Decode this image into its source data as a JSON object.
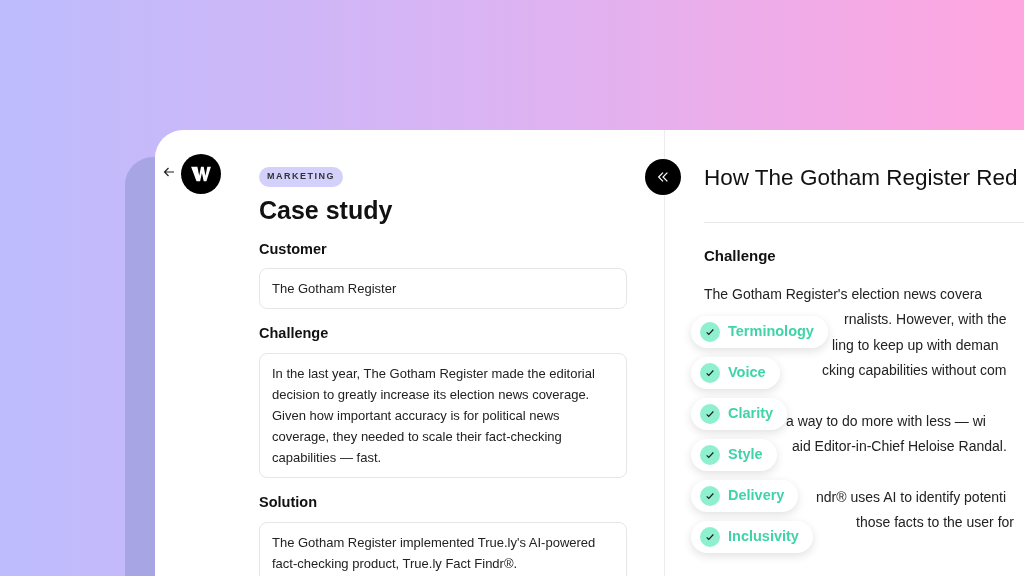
{
  "form": {
    "tag": "MARKETING",
    "title": "Case study",
    "fields": [
      {
        "label": "Customer",
        "value": "The Gotham Register"
      },
      {
        "label": "Challenge",
        "value": "In the last year, The Gotham Register made the editorial decision to greatly increase its election news coverage. Given how important accuracy is for political news coverage, they needed to scale their fact-checking capabilities — fast."
      },
      {
        "label": "Solution",
        "value": "The Gotham Register implemented True.ly's AI-powered fact-checking product, True.ly Fact Findr®."
      }
    ]
  },
  "preview": {
    "title": "How The Gotham Register Red",
    "heading": "Challenge",
    "paragraphs": [
      [
        "The Gotham Register's election news covera",
        "rnalists. However, with the",
        "ling to keep up with deman",
        "cking capabilities without com"
      ],
      [
        "a way to do more with less — wi",
        "aid Editor-in-Chief Heloise Randal."
      ],
      [
        "ndr® uses AI to identify potenti",
        "those facts to the user for"
      ]
    ]
  },
  "checks": [
    {
      "label": "Terminology",
      "checked": true
    },
    {
      "label": "Voice",
      "checked": true
    },
    {
      "label": "Clarity",
      "checked": true
    },
    {
      "label": "Style",
      "checked": true
    },
    {
      "label": "Delivery",
      "checked": true
    },
    {
      "label": "Inclusivity",
      "checked": true
    }
  ]
}
